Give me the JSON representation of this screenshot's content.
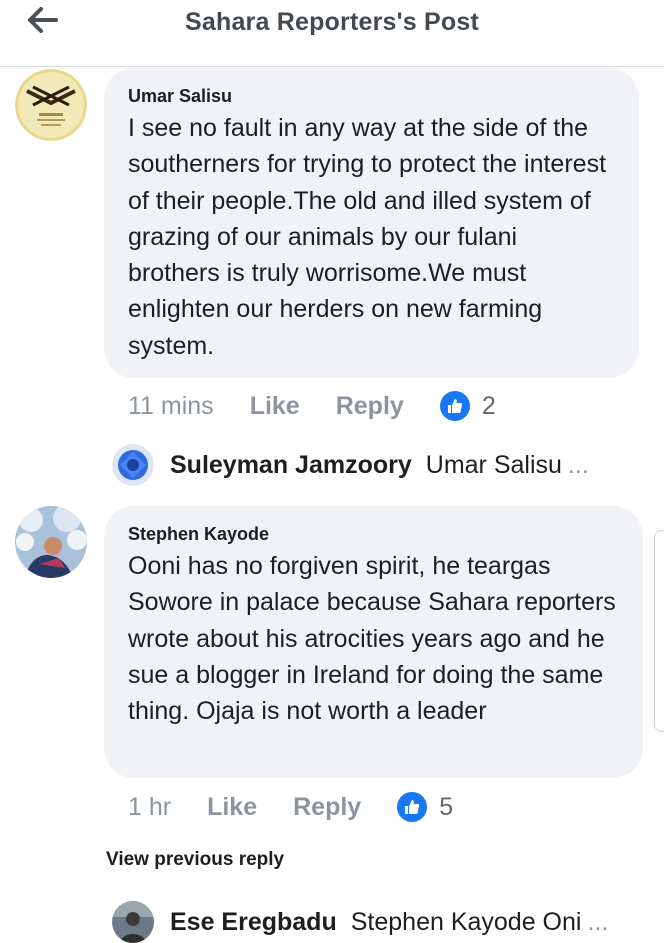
{
  "header": {
    "title": "Sahara Reporters's Post"
  },
  "comments": [
    {
      "author": "Umar Salisu",
      "text": "I see no fault in any way at the side of the southerners for trying to protect the interest of their people.The old and illed system of grazing of our animals by our fulani brothers is truly worrisome.We must enlighten our herders on new farming system.",
      "time": "11 mins",
      "like_label": "Like",
      "reply_label": "Reply",
      "reaction_count": "2",
      "reply_preview": {
        "name": "Suleyman Jamzoory",
        "snippet": "Umar Salisu",
        "ellipsis": "..."
      }
    },
    {
      "author": "Stephen Kayode",
      "text": "Ooni has no forgiven spirit, he teargas Sowore in palace because Sahara reporters wrote about his atrocities years ago and he sue a blogger in Ireland for doing the same thing. Ojaja is not worth a leader",
      "time": "1 hr",
      "like_label": "Like",
      "reply_label": "Reply",
      "reaction_count": "5",
      "view_previous": "View previous reply",
      "reply_preview": {
        "name": "Ese Eregbadu",
        "snippet": "Stephen Kayode Oni",
        "ellipsis": "..."
      }
    }
  ],
  "colors": {
    "accent": "#1877f2",
    "bubble": "#f0f2f5",
    "muted": "#8d949e"
  },
  "icons": {
    "back": "arrow-left-icon",
    "reaction": "thumbs-up-icon"
  }
}
